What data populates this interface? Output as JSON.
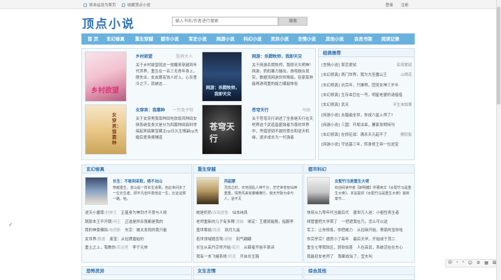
{
  "topbar": {
    "bookmark": "将本站设为首页",
    "favorite": "收藏顶点小说",
    "login": "登录",
    "register": "注册"
  },
  "header": {
    "logo": "顶点小说",
    "search_placeholder": "输入书名/作者进行搜索",
    "search_button": "搜索"
  },
  "nav": [
    "首 页",
    "玄幻修真",
    "重生穿越",
    "都市小说",
    "军史小说",
    "网游小说",
    "科幻小说",
    "灵异小说",
    "言情小说",
    "其他小说",
    "会员书架",
    "阅读记录"
  ],
  "featured": [
    {
      "title": "乡村欲望",
      "author": "鬓爽大人",
      "desc": "关于乡村欲望就这一觉醒来穿越到年代世界，重生在一名三无青年身上，刚失业，女友跟有钱人好上，心灰意冷之下，就被这…"
    },
    {
      "title": "网游：杀戮牧师，我即天灾",
      "author": "",
      "desc": "关于网游杀戮牧师，我即天灾明神！网游，奶妈暴力输出，游戏融合现实，数据流网游剑世降临，轻家蒸熟能再游戏重的能力爆裂体验"
    },
    {
      "title": "女穿男：我靠种",
      "author": "一只兔子呀",
      "desc": "关于女穿男我靠种田吃软饭风种田女频系统变身文是分为四篇种田搞科举搞起来搞聚宝藏主cp日久生情副cp先婚后爱身拥辅道"
    },
    {
      "title": "苍穹天行",
      "author": "马硕",
      "desc": "关于苍穹天行讲述了全身是天行在天吧界这个武道昌盛强者为尊的世界中，凭借坚韧不拔的意志和逆天机缘，逐步成长为一代强者"
    }
  ],
  "recommend": {
    "title": "经典推荐",
    "items": [
      {
        "cat": "[言情小说]",
        "name": "某恋爱狱",
        "author": "实现爱狱"
      },
      {
        "cat": "[玄幻修真]",
        "name": "两门世界，我为大圣魔山王",
        "author": "山得花"
      },
      {
        "cat": "[玄幻修真]",
        "name": "坑完年，只推啊，团宠女神三岁半",
        "author": ""
      },
      {
        "cat": "[玄幻修真]",
        "name": "生存虫巨在一号，明星老婆的请借借",
        "author": ""
      },
      {
        "cat": "[玄幻修真]",
        "name": "武天",
        "author": "平生未知寒"
      },
      {
        "cat": "[网游小说]",
        "name": "去踏遍全世，你成六星上师了?",
        "author": ""
      },
      {
        "cat": "[网游小说]",
        "name": "三国：开局法皿，屠家发明特刊",
        "author": ""
      },
      {
        "cat": "[玄幻修真]",
        "name": "在修征战：满杀天元起不了",
        "author": "楔叹影"
      },
      {
        "cat": "[网游小说]",
        "name": "守这基三年，转身修王帝一位说宝",
        "author": ""
      }
    ]
  },
  "sections": [
    {
      "head": "玄幻修真",
      "book": {
        "title": "长生：不敢到采取，绝不出山",
        "desc": "穿越重生，曾山是一样长生道果。自此世间多了一位长生者。即不凡但中意他这一生，比证证那一路。哈。"
      },
      "lines": [
        [
          "逆天小魔尊",
          "/刹神王",
          "正星身为神剑才不意与人将"
        ],
        [
          "跳那本王不开朝",
          "/闲王",
          "正选是异杀我都是我的"
        ],
        [
          "我的神豪模拟",
          "/电视剧",
          "东京：被太发现的我只能"
        ],
        [
          "女世界",
          "/数据",
          "废宝：从捡牌眉始的"
        ],
        [
          "重土之上，我教你",
          "/百冶里",
          "李于元帅"
        ]
      ]
    },
    {
      "head": "重生穿越",
      "book": {
        "title": "风起蒙",
        "desc": "灵前之时，天地混乱人神千分，茫茫世苍有仙神重重，情势风来有秦曦横行，我天开脉为卓与人，道不灭"
      },
      "lines": [
        [
          "她是奶奶",
          "/深海酒鬼",
          "仙本纯良"
        ],
        [
          "老师重新的儿子有多傅",
          "/顶端",
          "绑定：王德就能脱，指服李"
        ],
        [
          "盖世寒翁",
          "/别诺",
          "别月九遥"
        ],
        [
          "若世领域题否驾",
          "/谢锤",
          "别气翩翩"
        ],
        [
          "长生从高丹宗师开始",
          "/孤月",
          "从薛者开始",
          "平原诗"
        ],
        [
          "我有一本飞蛾系修",
          "/风流",
          "开启长生路"
        ]
      ]
    },
    {
      "head": "都市科幻",
      "book": {
        "title": "女配竹马是重生大佬",
        "desc": "欢迎阅读作者【斯明糖】所著爽文《女配竹马是重生大佬》，本站提供《女配竹马是重生大佬》最新章节…"
      },
      "lines": [
        [
          "快穿从九零年代当赢后代",
          "",
          "善世万人迷：小祖性青生者"
        ],
        [
          "倾管雷把大学首丁",
          "",
          "一把遮我在乃，怎么可以送"
        ],
        [
          "军工：让你修炼，你把威力",
          "",
          "从捡麻开始，寄惑的宝你哈"
        ],
        [
          "你完举完？遇房小了每年",
          "",
          "最后天学，开始成于顶二"
        ],
        [
          "重生七零我较区，骄软如喜",
          "",
          "人在高武，系统活在在东心"
        ],
        [
          "我最初女老师了",
          "",
          "我都成仙了，宜夫叫"
        ]
      ]
    }
  ],
  "bottom_sections": [
    "恐怖灵异",
    "女生言情",
    "综合其他"
  ],
  "ime": "中 ᵛ ⁹ ☺ ⚙ ▦ ⌨"
}
